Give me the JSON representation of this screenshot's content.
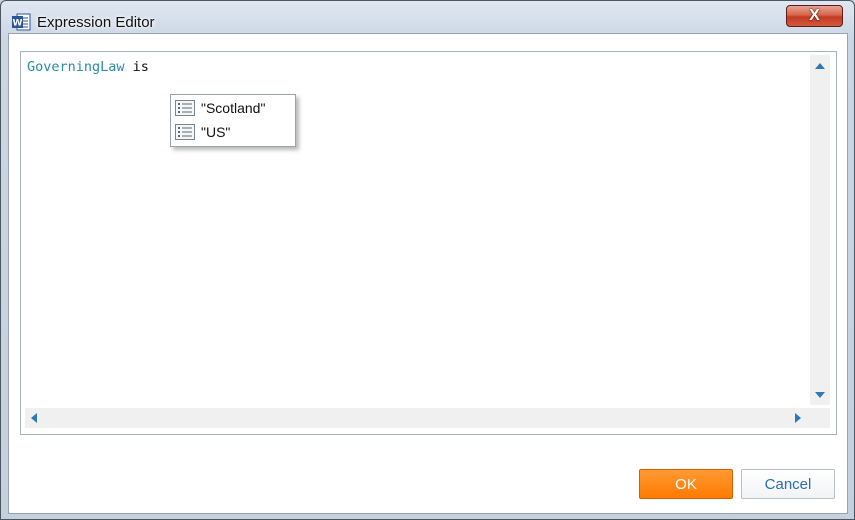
{
  "window": {
    "title": "Expression Editor",
    "app_icon": "word-icon",
    "close_label": "X"
  },
  "editor": {
    "field_token": "GoverningLaw",
    "operator_token": " is"
  },
  "autocomplete": {
    "items": [
      {
        "label": "\"Scotland\"",
        "icon": "list-value-icon"
      },
      {
        "label": "\"US\"",
        "icon": "list-value-icon"
      }
    ]
  },
  "buttons": {
    "ok_label": "OK",
    "cancel_label": "Cancel"
  },
  "colors": {
    "keyword": "#2a8aa8",
    "ok_button": "#ff7a00",
    "cancel_text": "#2b6cb0",
    "scroll_arrow": "#2e78b5"
  }
}
